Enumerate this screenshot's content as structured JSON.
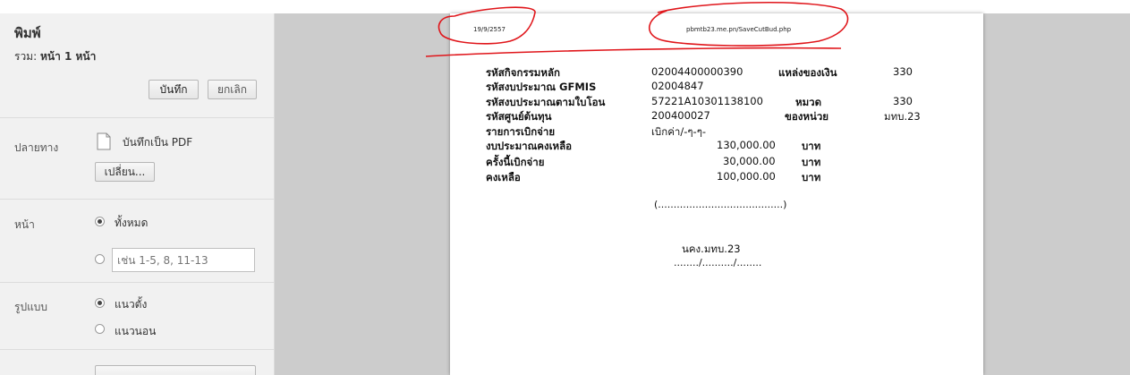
{
  "sidebar": {
    "title": "พิมพ์",
    "total_label": "รวม:",
    "total_value": "หน้า 1 หน้า",
    "save_label": "บันทึก",
    "cancel_label": "ยกเลิก",
    "destination": {
      "label": "ปลายทาง",
      "name": "บันทึกเป็น PDF",
      "change_label": "เปลี่ยน..."
    },
    "pages": {
      "label": "หน้า",
      "all_label": "ทั้งหมด",
      "range_placeholder": "เช่น 1-5, 8, 11-13",
      "selected": "all"
    },
    "layout": {
      "label": "รูปแบบ",
      "portrait_label": "แนวตั้ง",
      "landscape_label": "แนวนอน",
      "selected": "portrait"
    }
  },
  "document": {
    "header_date": "19/9/2557",
    "header_url": "pbmtb23.me.pn/SaveCutBud.php",
    "rows": {
      "activity_label": "รหัสกิจกรรมหลัก",
      "activity_value": "02004400000390",
      "source_label": "แหล่งของเงิน",
      "source_value": "330",
      "gfmis_label": "รหัสงบประมาณ GFMIS",
      "gfmis_value": "02004847",
      "transfer_label": "รหัสงบประมาณตามใบโอน",
      "transfer_value": "57221A10301138100",
      "category_label": "หมวด",
      "category_value": "330",
      "costcenter_label": "รหัสศูนย์ต้นทุน",
      "costcenter_value": "200400027",
      "unit_label": "ของหน่วย",
      "unit_value": "มทบ.23",
      "expense_label": "รายการเบิกจ่าย",
      "expense_value": "เบิกค่า/-ๆ-ๆ-",
      "remaining_budget_label": "งบประมาณคงเหลือ",
      "remaining_budget_value": "130,000.00",
      "remaining_budget_unit": "บาท",
      "this_payment_label": "ครั้งนี้เบิกจ่าย",
      "this_payment_value": "30,000.00",
      "this_payment_unit": "บาท",
      "balance_label": "คงเหลือ",
      "balance_value": "100,000.00",
      "balance_unit": "บาท"
    },
    "signature_line": "(........................................)",
    "signer_title": "นคง.มทบ.23",
    "date_line": "......../........../........"
  },
  "colors": {
    "sidebar_bg": "#f1f1f1",
    "preview_bg": "#cccccc",
    "annotation_red": "#e0161b"
  },
  "icons": {
    "destination": "pdf-file-icon"
  }
}
